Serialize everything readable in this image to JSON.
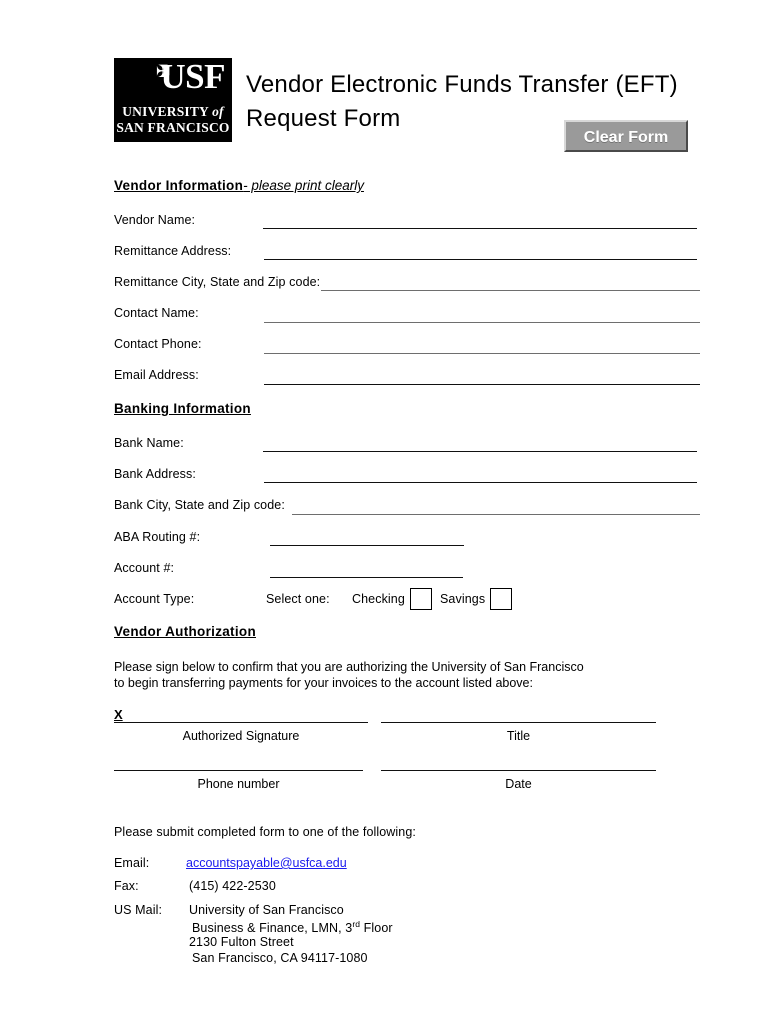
{
  "document": {
    "title_line1": "Vendor Electronic Funds Transfer (EFT)",
    "title_line2": "Request Form"
  },
  "logo": {
    "cross": "✠",
    "acronym": "USF",
    "university": "UNIVERSITY",
    "of": "of",
    "city": "SAN FRANCISCO"
  },
  "toolbar": {
    "clear_form_label": "Clear Form"
  },
  "vendor_information": {
    "heading": "Vendor Information",
    "subnote": "- please print clearly",
    "fields": [
      {
        "label": "Vendor Name:"
      },
      {
        "label": "Remittance Address:"
      },
      {
        "label": "Remittance City, State and Zip code:"
      },
      {
        "label": "Contact Name:"
      },
      {
        "label": "Contact Phone:"
      },
      {
        "label": "Email Address:"
      }
    ]
  },
  "banking_information": {
    "heading": "Banking Information",
    "fields": [
      {
        "label": "Bank Name:"
      },
      {
        "label": "Bank Address:"
      },
      {
        "label": "Bank City, State and Zip code:"
      },
      {
        "label": "ABA Routing #:"
      },
      {
        "label": "Account #:"
      }
    ],
    "account_type": {
      "label": "Account Type:",
      "select_label": "Select one:",
      "options": [
        {
          "label": "Checking",
          "checked": false
        },
        {
          "label": "Savings",
          "checked": false
        }
      ]
    }
  },
  "vendor_authorization": {
    "heading": "Vendor Authorization",
    "paragraph_line1": "Please sign below to confirm that you are authorizing the University of San Francisco",
    "paragraph_line2": "to begin transferring payments for your invoices to the account listed above:",
    "signature_marker": "X",
    "captions": {
      "authorized_signature": "Authorized Signature",
      "title": "Title",
      "phone_number": "Phone number",
      "date": "Date"
    }
  },
  "submission": {
    "intro": "Please submit completed form to one of the following:",
    "email_label": "Email:",
    "email_value": "accountspayable@usfca.edu",
    "fax_label": "Fax:",
    "fax_value": "(415) 422-2530",
    "mail_label": "US Mail:",
    "mail_line1": "University of San Francisco",
    "mail_line2_pre": "Business & Finance, LMN, 3",
    "mail_line2_sup": "rd",
    "mail_line2_post": " Floor",
    "mail_line3": "2130 Fulton Street",
    "mail_line4": "San Francisco, CA  94117-1080"
  }
}
